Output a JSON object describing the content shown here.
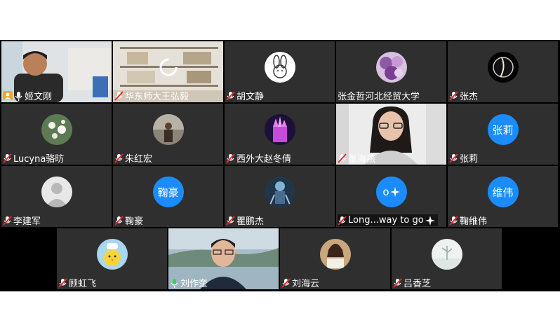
{
  "participants": [
    {
      "name": "姬文刚",
      "mic": "on",
      "host": true,
      "type": "video",
      "photo": "office"
    },
    {
      "name": "华东师大王弘毅",
      "mic": "off",
      "type": "video",
      "photo": "bookshelf"
    },
    {
      "name": "胡文静",
      "mic": "off",
      "type": "avatar",
      "photo": "cartoon-bunny"
    },
    {
      "name": "张金哲河北经贸大学",
      "mic": "none",
      "type": "avatar",
      "photo": "purple-flowers"
    },
    {
      "name": "张杰",
      "mic": "off",
      "type": "avatar",
      "photo": "eclipse"
    },
    {
      "name": "Lucyna骆昉",
      "mic": "off",
      "type": "avatar",
      "photo": "white-flowers"
    },
    {
      "name": "朱红宏",
      "mic": "off",
      "type": "avatar",
      "photo": "street-person"
    },
    {
      "name": "西外大赵冬倩",
      "mic": "off",
      "type": "avatar",
      "photo": "castle"
    },
    {
      "name": "张海燕",
      "mic": "off",
      "type": "video",
      "photo": "woman-glasses"
    },
    {
      "name": "张莉",
      "mic": "off",
      "type": "avatar",
      "initials": "张莉"
    },
    {
      "name": "李建军",
      "mic": "off",
      "type": "avatar",
      "photo": "default-person"
    },
    {
      "name": "鞠豪",
      "mic": "off",
      "type": "avatar",
      "initials": "鞠豪"
    },
    {
      "name": "瞿鹏杰",
      "mic": "off",
      "type": "avatar",
      "photo": "anime-figure"
    },
    {
      "name": "Long...way to go",
      "mic": "off",
      "type": "avatar",
      "initials": "o"
    },
    {
      "name": "鞠维伟",
      "mic": "off",
      "type": "avatar",
      "initials": "维伟"
    },
    {
      "name": "顾虹飞",
      "mic": "off",
      "type": "avatar",
      "photo": "chick-chef"
    },
    {
      "name": "刘作奎",
      "mic": "on",
      "type": "video",
      "photo": "man-lake"
    },
    {
      "name": "刘海云",
      "mic": "off",
      "type": "avatar",
      "photo": "girl-reading"
    },
    {
      "name": "吕香芝",
      "mic": "off",
      "type": "avatar",
      "photo": "winter-tree"
    }
  ],
  "colors": {
    "background": "#000000",
    "tile": "#2f2f2f",
    "host_badge": "#f5a623",
    "mic_on": "#3fcf5e",
    "mic_off": "#e02e2e",
    "initials_bg": "#1a8cff"
  }
}
